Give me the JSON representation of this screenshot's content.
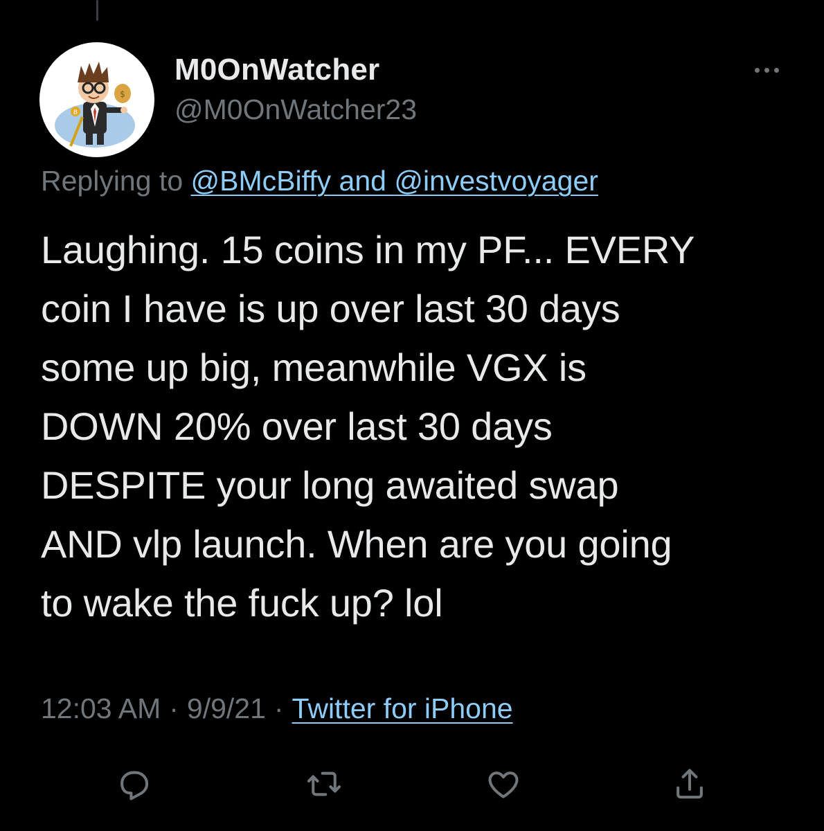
{
  "tweet": {
    "display_name": "M0OnWatcher",
    "handle": "@M0OnWatcher23",
    "replying_prefix": "Replying to ",
    "replying_to_1": "@BMcBiffy",
    "replying_and": " and ",
    "replying_to_2": "@investvoyager",
    "text_lines": [
      "Laughing. 15 coins in my PF... EVERY",
      "coin I have is up over last 30 days",
      "some up big, meanwhile VGX is",
      "DOWN 20% over last 30 days",
      "DESPITE your long awaited swap",
      "AND vlp launch. When are you going",
      "to wake the fuck up? lol"
    ],
    "time": "12:03 AM",
    "separator": "·",
    "date": "9/9/21",
    "source": "Twitter for iPhone"
  },
  "actions": {
    "reply_icon": "reply-icon",
    "retweet_icon": "retweet-icon",
    "like_icon": "like-icon",
    "share_icon": "share-icon"
  },
  "colors": {
    "background": "#000000",
    "text": "#e7e9ea",
    "muted": "#71767b",
    "link": "#8ecdf8"
  }
}
